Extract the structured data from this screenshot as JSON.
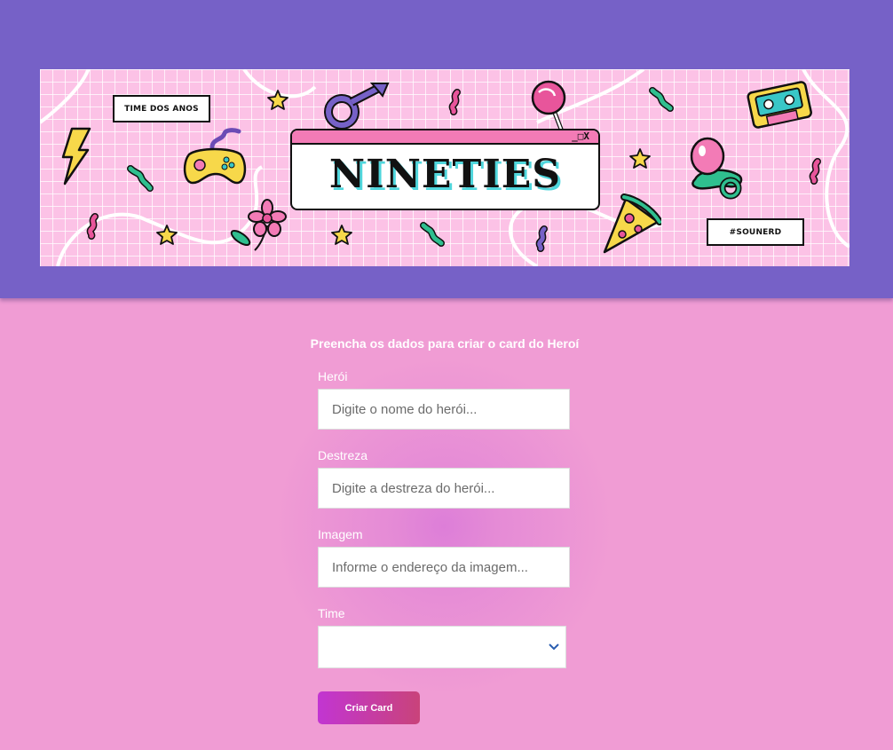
{
  "banner": {
    "tag_left": "TIME DOS ANOS",
    "title": "NINETIES",
    "window_controls": "_□X",
    "tag_right": "#SOUNERD"
  },
  "form": {
    "heading": "Preencha os dados para criar o card do Heroí",
    "hero_label": "Herói",
    "hero_placeholder": "Digite o nome do herói...",
    "dexterity_label": "Destreza",
    "dexterity_placeholder": "Digite a destreza do herói...",
    "image_label": "Imagem",
    "image_placeholder": "Informe o endereço da imagem...",
    "team_label": "Time",
    "team_selected": "",
    "submit_label": "Criar Card"
  },
  "colors": {
    "header_bg": "#7661c7",
    "page_bg": "#f09cd4",
    "banner_bg": "#fcc2e6",
    "button_start": "#c235d2",
    "button_end": "#c9437a"
  }
}
